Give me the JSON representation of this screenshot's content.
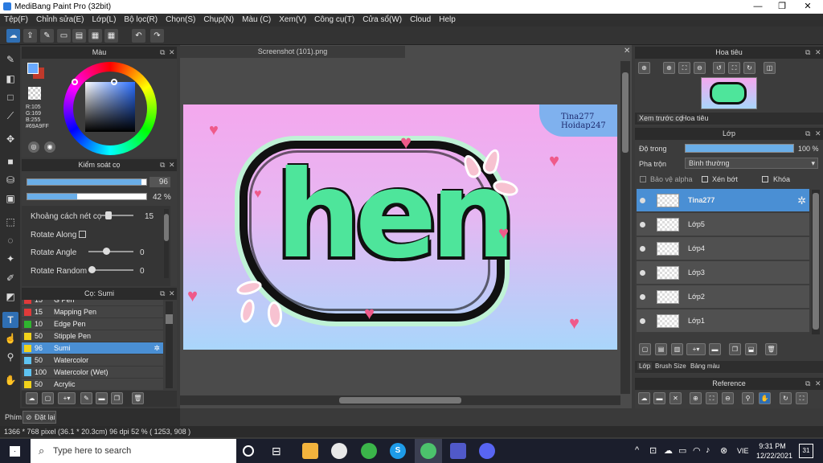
{
  "window": {
    "title": "MediBang Paint Pro (32bit)",
    "minimize": "—",
    "maximize": "❐",
    "close": "✕"
  },
  "menu": [
    "Tệp(F)",
    "Chỉnh sửa(E)",
    "Lớp(L)",
    "Bộ lọc(R)",
    "Chọn(S)",
    "Chụp(N)",
    "Màu (C)",
    "Xem(V)",
    "Công cụ(T)",
    "Cửa sổ(W)",
    "Cloud",
    "Help"
  ],
  "color_panel": {
    "title": "Màu",
    "r": "R:105",
    "g": "G:169",
    "b": "B:255",
    "hex": "#69A9FF",
    "primary_color": "#69A9FF",
    "secondary_color": "#c0392b"
  },
  "brush_control": {
    "title": "Kiểm soát cọ",
    "size_value": "96",
    "opacity_value": "42",
    "opacity_unit": "%",
    "size_fraction": 0.96,
    "opacity_fraction": 0.42,
    "spacing_label": "Khoảng cách nét cọ",
    "spacing_value": "15",
    "rotate_along_label": "Rotate Along",
    "rotate_angle_label": "Rotate Angle",
    "rotate_angle_value": "0",
    "rotate_random_label": "Rotate Random",
    "rotate_random_value": "0"
  },
  "brush_list": {
    "title": "Cọ: Sumi",
    "items": [
      {
        "size": "15",
        "name": "G Pen",
        "color": "#e03a3a"
      },
      {
        "size": "15",
        "name": "Mapping Pen",
        "color": "#e03a3a"
      },
      {
        "size": "10",
        "name": "Edge Pen",
        "color": "#2fb52f"
      },
      {
        "size": "50",
        "name": "Stipple Pen",
        "color": "#f1d21b"
      },
      {
        "size": "96",
        "name": "Sumi",
        "color": "#f1d21b"
      },
      {
        "size": "50",
        "name": "Watercolor",
        "color": "#5ec3f2"
      },
      {
        "size": "100",
        "name": "Watercolor (Wet)",
        "color": "#5ec3f2"
      },
      {
        "size": "50",
        "name": "Acrylic",
        "color": "#f1d21b"
      }
    ]
  },
  "document": {
    "tab": "Screenshot (101).png",
    "art_text": "hen",
    "watermark_line1": "Tina277",
    "watermark_line2": "Hoidap247"
  },
  "navigator": {
    "title": "Hoa tiêu",
    "tab_preview": "Xem trước cọ",
    "tab_nav": "Hoa tiêu"
  },
  "layers": {
    "title": "Lớp",
    "opacity_label": "Độ trong",
    "opacity_value": "100 %",
    "opacity_fraction": 1.0,
    "blend_label": "Pha trộn",
    "blend_value": "Bình thường",
    "protect_alpha": "Bảo vệ alpha",
    "clipping": "Xén bớt",
    "lock": "Khóa",
    "items": [
      {
        "name": "Tina277",
        "selected": true
      },
      {
        "name": "Lớp5",
        "selected": false
      },
      {
        "name": "Lớp4",
        "selected": false
      },
      {
        "name": "Lớp3",
        "selected": false
      },
      {
        "name": "Lớp2",
        "selected": false
      },
      {
        "name": "Lớp1",
        "selected": false
      }
    ],
    "tabs": [
      "Lớp",
      "Brush Size",
      "Bảng màu"
    ]
  },
  "reference": {
    "title": "Reference"
  },
  "bottom_left": {
    "tab": "Phím",
    "reset": "Đặt lại"
  },
  "status": {
    "text": "1366 * 768 pixel  (36.1 * 20.3cm)  96 dpi  52 %  ( 1253, 908 )"
  },
  "taskbar": {
    "search_placeholder": "Type here to search",
    "lang": "VIE",
    "time": "9:31 PM",
    "date": "12/22/2021",
    "notif_count": "31"
  }
}
